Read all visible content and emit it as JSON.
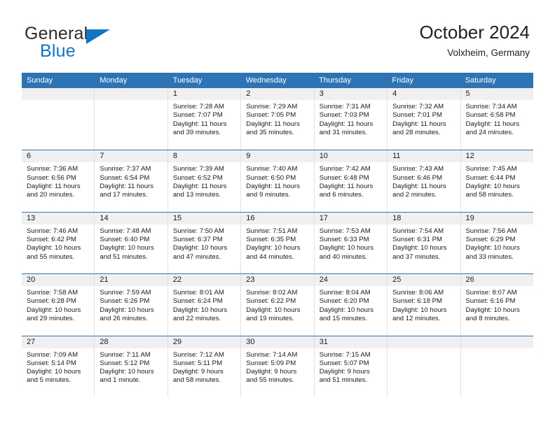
{
  "brand": {
    "name_part1": "General",
    "name_part2": "Blue",
    "flag_icon": "triangle-flag-icon"
  },
  "header": {
    "title": "October 2024",
    "subtitle": "Volxheim, Germany"
  },
  "colors": {
    "header_blue": "#2e74b5",
    "brand_blue": "#1275c1",
    "daynum_band": "#f0f0f0",
    "cell_border": "#e2e2e2"
  },
  "weekdays": [
    "Sunday",
    "Monday",
    "Tuesday",
    "Wednesday",
    "Thursday",
    "Friday",
    "Saturday"
  ],
  "labels": {
    "sunrise_prefix": "Sunrise:",
    "sunset_prefix": "Sunset:",
    "daylight_prefix": "Daylight:"
  },
  "weeks": [
    [
      {
        "day": "",
        "empty": true
      },
      {
        "day": "",
        "empty": true
      },
      {
        "day": "1",
        "sunrise": "Sunrise: 7:28 AM",
        "sunset": "Sunset: 7:07 PM",
        "daylight1": "Daylight: 11 hours",
        "daylight2": "and 39 minutes."
      },
      {
        "day": "2",
        "sunrise": "Sunrise: 7:29 AM",
        "sunset": "Sunset: 7:05 PM",
        "daylight1": "Daylight: 11 hours",
        "daylight2": "and 35 minutes."
      },
      {
        "day": "3",
        "sunrise": "Sunrise: 7:31 AM",
        "sunset": "Sunset: 7:03 PM",
        "daylight1": "Daylight: 11 hours",
        "daylight2": "and 31 minutes."
      },
      {
        "day": "4",
        "sunrise": "Sunrise: 7:32 AM",
        "sunset": "Sunset: 7:01 PM",
        "daylight1": "Daylight: 11 hours",
        "daylight2": "and 28 minutes."
      },
      {
        "day": "5",
        "sunrise": "Sunrise: 7:34 AM",
        "sunset": "Sunset: 6:58 PM",
        "daylight1": "Daylight: 11 hours",
        "daylight2": "and 24 minutes."
      }
    ],
    [
      {
        "day": "6",
        "sunrise": "Sunrise: 7:36 AM",
        "sunset": "Sunset: 6:56 PM",
        "daylight1": "Daylight: 11 hours",
        "daylight2": "and 20 minutes."
      },
      {
        "day": "7",
        "sunrise": "Sunrise: 7:37 AM",
        "sunset": "Sunset: 6:54 PM",
        "daylight1": "Daylight: 11 hours",
        "daylight2": "and 17 minutes."
      },
      {
        "day": "8",
        "sunrise": "Sunrise: 7:39 AM",
        "sunset": "Sunset: 6:52 PM",
        "daylight1": "Daylight: 11 hours",
        "daylight2": "and 13 minutes."
      },
      {
        "day": "9",
        "sunrise": "Sunrise: 7:40 AM",
        "sunset": "Sunset: 6:50 PM",
        "daylight1": "Daylight: 11 hours",
        "daylight2": "and 9 minutes."
      },
      {
        "day": "10",
        "sunrise": "Sunrise: 7:42 AM",
        "sunset": "Sunset: 6:48 PM",
        "daylight1": "Daylight: 11 hours",
        "daylight2": "and 6 minutes."
      },
      {
        "day": "11",
        "sunrise": "Sunrise: 7:43 AM",
        "sunset": "Sunset: 6:46 PM",
        "daylight1": "Daylight: 11 hours",
        "daylight2": "and 2 minutes."
      },
      {
        "day": "12",
        "sunrise": "Sunrise: 7:45 AM",
        "sunset": "Sunset: 6:44 PM",
        "daylight1": "Daylight: 10 hours",
        "daylight2": "and 58 minutes."
      }
    ],
    [
      {
        "day": "13",
        "sunrise": "Sunrise: 7:46 AM",
        "sunset": "Sunset: 6:42 PM",
        "daylight1": "Daylight: 10 hours",
        "daylight2": "and 55 minutes."
      },
      {
        "day": "14",
        "sunrise": "Sunrise: 7:48 AM",
        "sunset": "Sunset: 6:40 PM",
        "daylight1": "Daylight: 10 hours",
        "daylight2": "and 51 minutes."
      },
      {
        "day": "15",
        "sunrise": "Sunrise: 7:50 AM",
        "sunset": "Sunset: 6:37 PM",
        "daylight1": "Daylight: 10 hours",
        "daylight2": "and 47 minutes."
      },
      {
        "day": "16",
        "sunrise": "Sunrise: 7:51 AM",
        "sunset": "Sunset: 6:35 PM",
        "daylight1": "Daylight: 10 hours",
        "daylight2": "and 44 minutes."
      },
      {
        "day": "17",
        "sunrise": "Sunrise: 7:53 AM",
        "sunset": "Sunset: 6:33 PM",
        "daylight1": "Daylight: 10 hours",
        "daylight2": "and 40 minutes."
      },
      {
        "day": "18",
        "sunrise": "Sunrise: 7:54 AM",
        "sunset": "Sunset: 6:31 PM",
        "daylight1": "Daylight: 10 hours",
        "daylight2": "and 37 minutes."
      },
      {
        "day": "19",
        "sunrise": "Sunrise: 7:56 AM",
        "sunset": "Sunset: 6:29 PM",
        "daylight1": "Daylight: 10 hours",
        "daylight2": "and 33 minutes."
      }
    ],
    [
      {
        "day": "20",
        "sunrise": "Sunrise: 7:58 AM",
        "sunset": "Sunset: 6:28 PM",
        "daylight1": "Daylight: 10 hours",
        "daylight2": "and 29 minutes."
      },
      {
        "day": "21",
        "sunrise": "Sunrise: 7:59 AM",
        "sunset": "Sunset: 6:26 PM",
        "daylight1": "Daylight: 10 hours",
        "daylight2": "and 26 minutes."
      },
      {
        "day": "22",
        "sunrise": "Sunrise: 8:01 AM",
        "sunset": "Sunset: 6:24 PM",
        "daylight1": "Daylight: 10 hours",
        "daylight2": "and 22 minutes."
      },
      {
        "day": "23",
        "sunrise": "Sunrise: 8:02 AM",
        "sunset": "Sunset: 6:22 PM",
        "daylight1": "Daylight: 10 hours",
        "daylight2": "and 19 minutes."
      },
      {
        "day": "24",
        "sunrise": "Sunrise: 8:04 AM",
        "sunset": "Sunset: 6:20 PM",
        "daylight1": "Daylight: 10 hours",
        "daylight2": "and 15 minutes."
      },
      {
        "day": "25",
        "sunrise": "Sunrise: 8:06 AM",
        "sunset": "Sunset: 6:18 PM",
        "daylight1": "Daylight: 10 hours",
        "daylight2": "and 12 minutes."
      },
      {
        "day": "26",
        "sunrise": "Sunrise: 8:07 AM",
        "sunset": "Sunset: 6:16 PM",
        "daylight1": "Daylight: 10 hours",
        "daylight2": "and 8 minutes."
      }
    ],
    [
      {
        "day": "27",
        "sunrise": "Sunrise: 7:09 AM",
        "sunset": "Sunset: 5:14 PM",
        "daylight1": "Daylight: 10 hours",
        "daylight2": "and 5 minutes."
      },
      {
        "day": "28",
        "sunrise": "Sunrise: 7:11 AM",
        "sunset": "Sunset: 5:12 PM",
        "daylight1": "Daylight: 10 hours",
        "daylight2": "and 1 minute."
      },
      {
        "day": "29",
        "sunrise": "Sunrise: 7:12 AM",
        "sunset": "Sunset: 5:11 PM",
        "daylight1": "Daylight: 9 hours",
        "daylight2": "and 58 minutes."
      },
      {
        "day": "30",
        "sunrise": "Sunrise: 7:14 AM",
        "sunset": "Sunset: 5:09 PM",
        "daylight1": "Daylight: 9 hours",
        "daylight2": "and 55 minutes."
      },
      {
        "day": "31",
        "sunrise": "Sunrise: 7:15 AM",
        "sunset": "Sunset: 5:07 PM",
        "daylight1": "Daylight: 9 hours",
        "daylight2": "and 51 minutes."
      },
      {
        "day": "",
        "empty": true
      },
      {
        "day": "",
        "empty": true
      }
    ]
  ]
}
